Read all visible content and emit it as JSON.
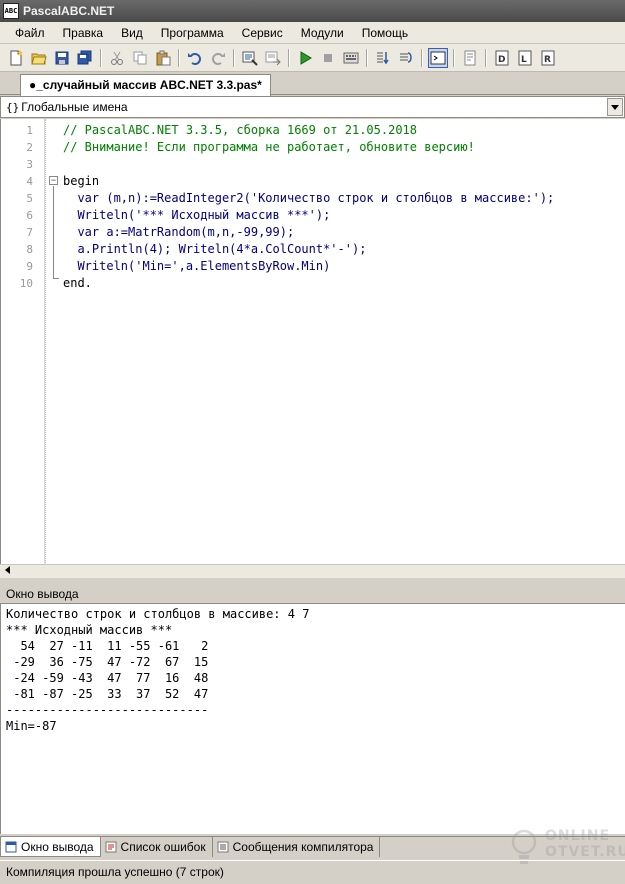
{
  "window": {
    "title": "PascalABC.NET",
    "icon_text": "ABC"
  },
  "menu": [
    "Файл",
    "Правка",
    "Вид",
    "Программа",
    "Сервис",
    "Модули",
    "Помощь"
  ],
  "toolbar": {
    "icons": [
      "new-file-icon",
      "open-folder-icon",
      "save-icon",
      "save-all-icon",
      "cut-icon",
      "copy-icon",
      "paste-icon",
      "undo-icon",
      "redo-icon",
      "find-icon",
      "replace-icon",
      "run-icon",
      "stop-icon",
      "compile-icon",
      "step-into-icon",
      "step-over-icon",
      "console-icon",
      "debug-window-icon",
      "format-code-icon",
      "watch-icon",
      "locals-icon"
    ]
  },
  "editor": {
    "tab_label": "●_случайный массив ABC.NET 3.3.pas*",
    "scope": {
      "icon": "{}",
      "label": "Глобальные имена"
    },
    "lines": [
      {
        "n": "1",
        "text": "// PascalABC.NET 3.3.5, сборка 1669 от 21.05.2018",
        "cls": "comment",
        "indent": 0
      },
      {
        "n": "2",
        "text": "// Внимание! Если программа не работает, обновите версию!",
        "cls": "comment",
        "indent": 0
      },
      {
        "n": "3",
        "text": "",
        "cls": "",
        "indent": 0
      },
      {
        "n": "4",
        "text": "begin",
        "cls": "kw",
        "indent": 0
      },
      {
        "n": "5",
        "text": "  var (m,n):=ReadInteger2('Количество строк и столбцов в массиве:');",
        "cls": "",
        "indent": 0
      },
      {
        "n": "6",
        "text": "  Writeln('*** Исходный массив ***');",
        "cls": "",
        "indent": 0
      },
      {
        "n": "7",
        "text": "  var a:=MatrRandom(m,n,-99,99);",
        "cls": "",
        "indent": 0
      },
      {
        "n": "8",
        "text": "  a.Println(4); Writeln(4*a.ColCount*'-');",
        "cls": "",
        "indent": 0
      },
      {
        "n": "9",
        "text": "  Writeln('Min=',a.ElementsByRow.Min)",
        "cls": "",
        "indent": 0
      },
      {
        "n": "10",
        "text": "end.",
        "cls": "kw",
        "indent": 0
      }
    ]
  },
  "output": {
    "header": "Окно вывода",
    "lines": [
      "Количество строк и столбцов в массиве: 4 7",
      "*** Исходный массив ***",
      "  54  27 -11  11 -55 -61   2",
      " -29  36 -75  47 -72  67  15",
      " -24 -59 -43  47  77  16  48",
      " -81 -87 -25  33  37  52  47",
      "----------------------------",
      "Min=-87"
    ]
  },
  "bottom_tabs": [
    {
      "label": "Окно вывода",
      "icon": "output-window-icon",
      "active": true
    },
    {
      "label": "Список ошибок",
      "icon": "error-list-icon",
      "active": false
    },
    {
      "label": "Сообщения компилятора",
      "icon": "compiler-messages-icon",
      "active": false
    }
  ],
  "status": "Компиляция прошла успешно (7 строк)",
  "watermark": {
    "line1": "ONLINE",
    "line2": "OTVET.RU"
  }
}
